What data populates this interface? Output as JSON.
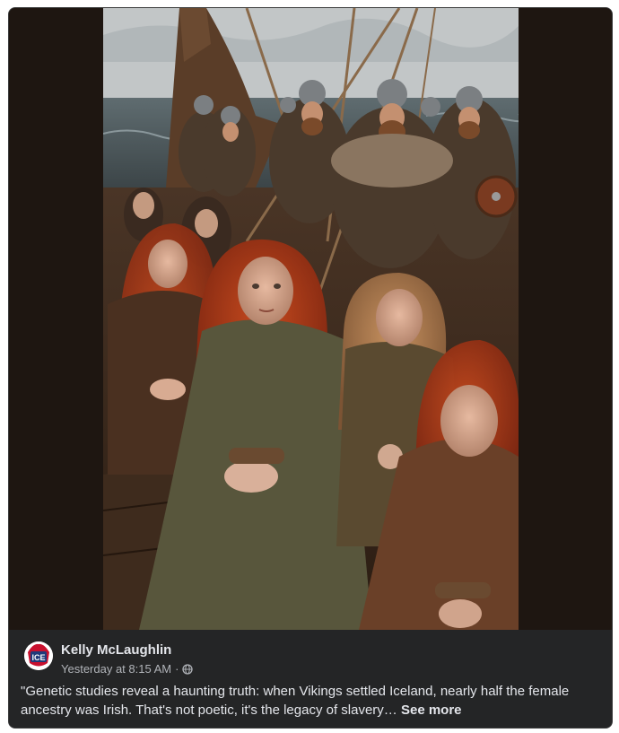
{
  "post": {
    "author_name": "Kelly McLaughlin",
    "timestamp": "Yesterday at 8:15 AM",
    "separator": "·",
    "privacy_icon": "globe-icon",
    "caption_text": "\"Genetic studies reveal a haunting truth: when Vikings settled Iceland, nearly half the female ancestry was Irish. That's not poetic, it's the legacy of slavery…",
    "see_more_label": "See more",
    "avatar_badge_text": "ICE"
  },
  "colors": {
    "card_background": "#242526",
    "primary_text": "#e4e6eb",
    "secondary_text": "#b0b3b8",
    "media_letterbox": "#1e1611"
  }
}
